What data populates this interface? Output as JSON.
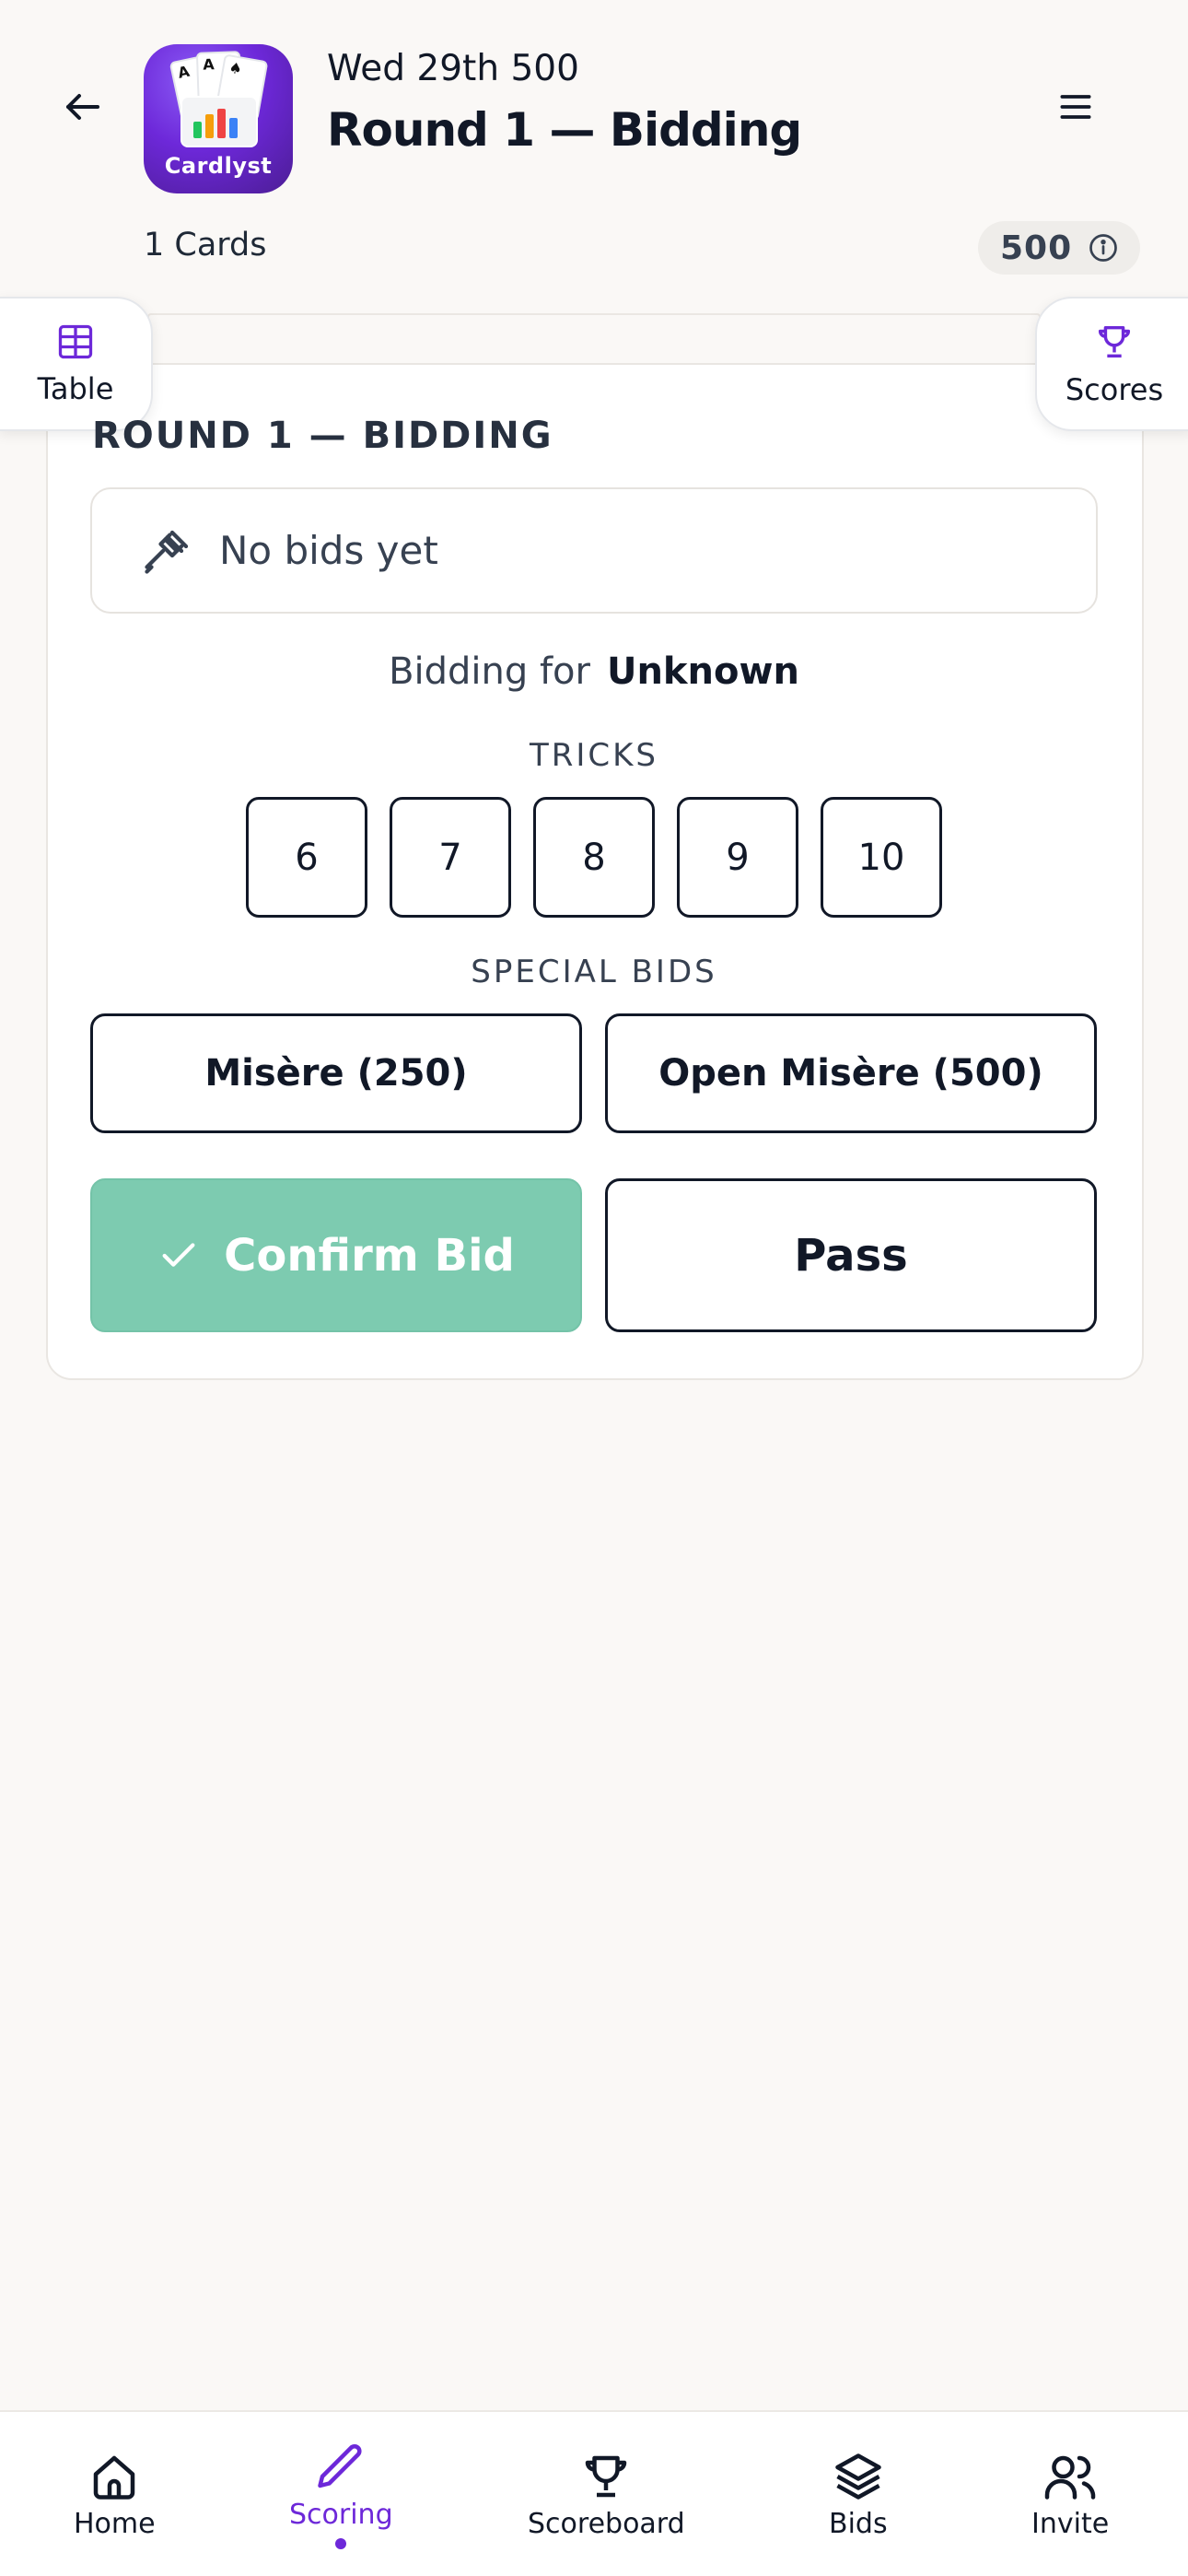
{
  "header": {
    "subtitle": "Wed 29th 500",
    "title": "Round 1 — Bidding",
    "app_icon_label": "Cardlyst",
    "cards_count": "1 Cards",
    "score_chip": "500"
  },
  "side_tabs": {
    "left": "Table",
    "right": "Scores"
  },
  "bidding": {
    "section_title": "ROUND 1 — BIDDING",
    "no_bids": "No bids yet",
    "bidding_for_label": "Bidding for",
    "bidding_for_value": "Unknown",
    "tricks_title": "TRICKS",
    "tricks": [
      "6",
      "7",
      "8",
      "9",
      "10"
    ],
    "special_title": "SPECIAL BIDS",
    "special": [
      "Misère (250)",
      "Open Misère (500)"
    ],
    "confirm_label": "Confirm Bid",
    "pass_label": "Pass"
  },
  "colors": {
    "accent": "#6d28d9",
    "confirm": "#7dcbb0",
    "background": "#faf8f6"
  },
  "nav": {
    "items": [
      {
        "label": "Home",
        "icon": "home-icon"
      },
      {
        "label": "Scoring",
        "icon": "pencil-icon"
      },
      {
        "label": "Scoreboard",
        "icon": "trophy-icon"
      },
      {
        "label": "Bids",
        "icon": "layers-icon"
      },
      {
        "label": "Invite",
        "icon": "users-icon"
      }
    ],
    "active": "Scoring"
  }
}
